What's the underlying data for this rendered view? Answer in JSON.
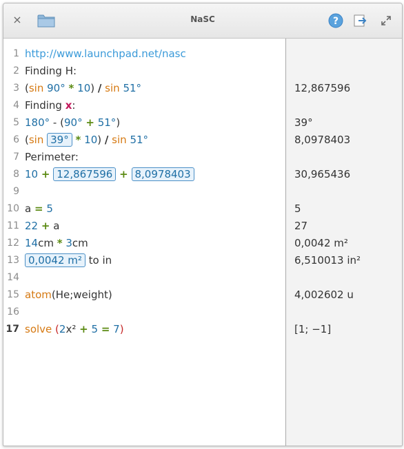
{
  "window": {
    "title": "NaSC",
    "close_glyph": "×",
    "icons": [
      "close-icon",
      "folder-icon",
      "help-icon",
      "export-icon",
      "maximize-icon"
    ],
    "help_glyph": "?"
  },
  "colors": {
    "function": "#d67a13",
    "number": "#1f6fa5",
    "operator": "#5b8a12",
    "variable": "#c2185b",
    "link": "#3a9ad9",
    "box_border": "#4a8fc6",
    "box_fill": "#e7f2fb",
    "results_background": "#f3f3f3"
  },
  "editor": {
    "line_numbers": [
      "1",
      "2",
      "3",
      "4",
      "5",
      "6",
      "7",
      "8",
      "9",
      "10",
      "11",
      "12",
      "13",
      "14",
      "15",
      "16",
      "17"
    ],
    "current_line": "17",
    "l1": {
      "link": "http://www.launchpad.net/nasc"
    },
    "l2": {
      "text": "Finding H:"
    },
    "l3": {
      "open": "(",
      "fn1": "sin",
      "n1": "90°",
      "op1": "*",
      "n2": "10",
      "close": ")",
      "div": "/",
      "fn2": "sin",
      "n3": "51°"
    },
    "l4": {
      "text": "Finding",
      "var": "x",
      "colon": ":"
    },
    "l5": {
      "n1": "180°",
      "minus": "-",
      "open": "(",
      "n2": "90°",
      "plus": "+",
      "n3": "51°",
      "close": ")"
    },
    "l6": {
      "open": "(",
      "fn1": "sin",
      "box": "39°",
      "op1": "*",
      "n1": "10",
      "close": ")",
      "div": "/",
      "fn2": "sin",
      "n2": "51°"
    },
    "l7": {
      "text": "Perimeter:"
    },
    "l8": {
      "n1": "10",
      "plus1": "+",
      "box1": "12,867596",
      "plus2": "+",
      "box2": "8,0978403"
    },
    "l10": {
      "a": "a",
      "eq": "=",
      "n": "5"
    },
    "l11": {
      "n": "22",
      "plus": "+",
      "a": "a"
    },
    "l12": {
      "n1": "14",
      "u1": "cm",
      "op": "*",
      "n2": "3",
      "u2": "cm"
    },
    "l13": {
      "box": "0,0042 m²",
      "rest": "to in"
    },
    "l15": {
      "fn": "atom",
      "args": "(He;weight)"
    },
    "l17": {
      "fn": "solve",
      "open": "(",
      "n1": "2",
      "x": "x²",
      "plus": "+",
      "n2": "5",
      "eq": "=",
      "n3": "7",
      "close": ")"
    }
  },
  "results": {
    "r3": "12,867596",
    "r5": "39°",
    "r6": "8,0978403",
    "r8": "30,965436",
    "r10": "5",
    "r11": "27",
    "r12": "0,0042 m²",
    "r13": "6,510013 in²",
    "r15": "4,002602 u",
    "r17": "[1; −1]"
  }
}
